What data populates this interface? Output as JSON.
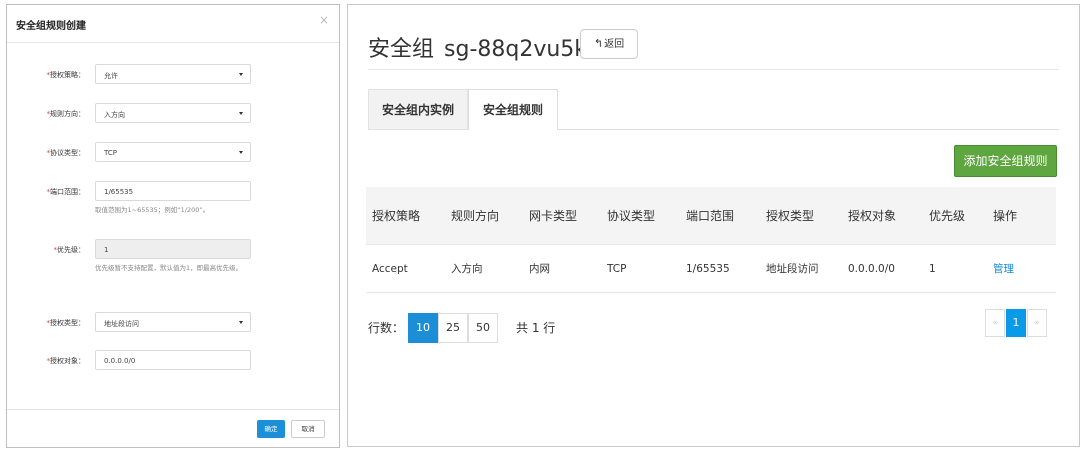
{
  "dialog": {
    "title": "安全组规则创建",
    "close": "×",
    "fields": {
      "policy": {
        "label": "*授权策略：",
        "value": "允许"
      },
      "direction": {
        "label": "*规则方向：",
        "value": "入方向"
      },
      "protocol": {
        "label": "*协议类型：",
        "value": "TCP"
      },
      "port": {
        "label": "*端口范围：",
        "value": "1/65535",
        "hint": "取值范围为1~65535；例如“1/200”。"
      },
      "priority": {
        "label": "*优先级：",
        "value": "1",
        "hint": "优先级暂不支持配置，默认值为1，即最高优先级。"
      },
      "auth_type": {
        "label": "*授权类型：",
        "value": "地址段访问"
      },
      "auth_object": {
        "label": "*授权对象：",
        "value": "0.0.0.0/0"
      }
    },
    "ok_label": "确定",
    "cancel_label": "取消"
  },
  "panel": {
    "title": "安全组",
    "group_id": "sg-88q2vu5kz",
    "back_label": "返回",
    "tabs": [
      "安全组内实例",
      "安全组规则"
    ],
    "add_button": "添加安全组规则",
    "table": {
      "headers": [
        "授权策略",
        "规则方向",
        "网卡类型",
        "协议类型",
        "端口范围",
        "授权类型",
        "授权对象",
        "优先级",
        "操作"
      ],
      "rows": [
        [
          "Accept",
          "入方向",
          "内网",
          "TCP",
          "1/65535",
          "地址段访问",
          "0.0.0.0/0",
          "1",
          "管理"
        ]
      ]
    },
    "pager": {
      "rows_label": "行数：",
      "sizes": [
        "10",
        "25",
        "50"
      ],
      "total": "共 1 行",
      "prev": "«",
      "current": "1",
      "next": "»"
    }
  },
  "colors": {
    "primary_blue": "#1c8ed6",
    "add_green": "#5ea63f",
    "required_red": "#e53935"
  }
}
